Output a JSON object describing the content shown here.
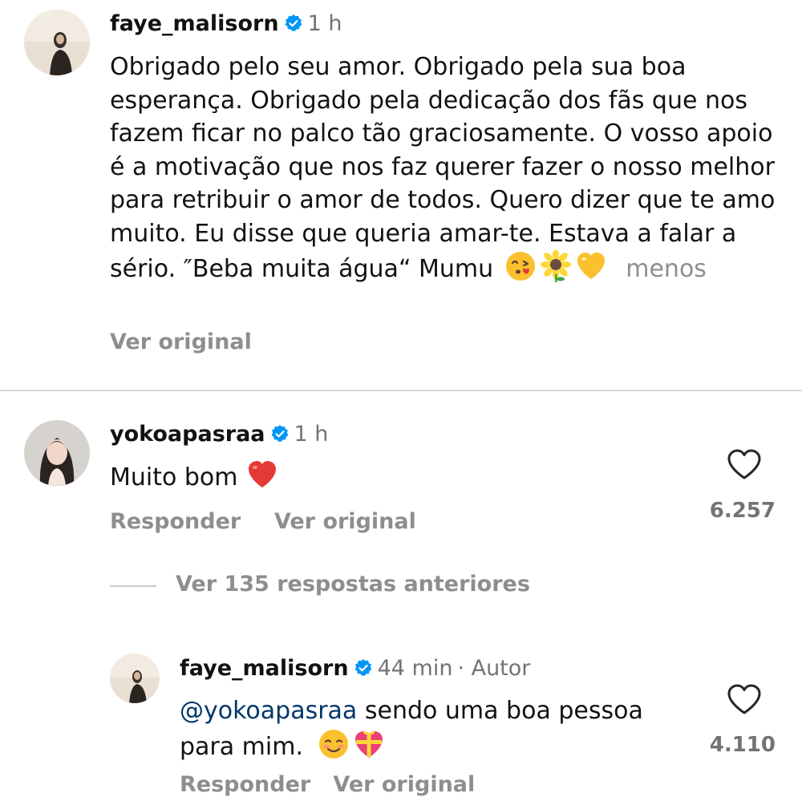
{
  "post_caption": {
    "username": "faye_malisorn",
    "time": "1 h",
    "text": "Obrigado pelo seu amor. Obrigado pela sua boa esperança. Obrigado pela dedicação dos fãs que nos fazem ficar no palco tão graciosamente. O vosso apoio é a motivação que nos faz querer fazer o nosso melhor para retribuir o amor de todos. Quero dizer que te amo muito. Eu disse que queria amar-te. Estava a falar a sério. ″Beba muita água“ Mumu",
    "less_label": "menos",
    "see_original_label": "Ver original"
  },
  "comment": {
    "username": "yokoapasraa",
    "time": "1 h",
    "text": "Muito bom",
    "reply_label": "Responder",
    "see_original_label": "Ver original",
    "like_count": "6.257"
  },
  "view_replies_label": "Ver 135 respostas anteriores",
  "reply": {
    "username": "faye_malisorn",
    "time": "44 min",
    "author_tag": "· Autor",
    "mention": "@yokoapasraa",
    "text_after_mention": "sendo uma boa pessoa para mim.",
    "like_count": "4.110",
    "cut_actions_label": "Responder   Ver original"
  },
  "icons": {
    "verified": "verified-badge-icon",
    "heart": "heart-outline-icon",
    "kiss_emoji": "face-blowing-kiss-emoji",
    "sunflower_emoji": "sunflower-emoji",
    "yellow_heart_emoji": "yellow-heart-emoji",
    "red_heart_emoji": "red-heart-emoji",
    "smiling_emoji": "smiling-face-emoji",
    "gift_heart_emoji": "heart-with-ribbon-emoji"
  },
  "colors": {
    "verified_blue": "#0095f6",
    "secondary_text": "#8e8e8e",
    "mention_blue": "#00376b"
  }
}
